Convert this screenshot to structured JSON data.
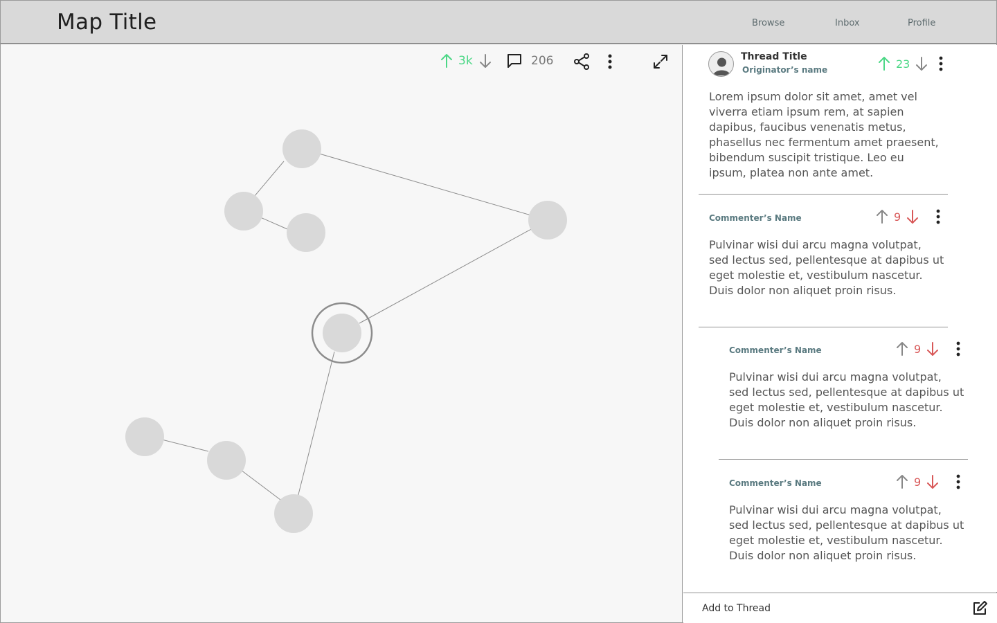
{
  "header": {
    "title": "Map Title",
    "nav": [
      "Browse",
      "Inbox",
      "Profile"
    ]
  },
  "toolbar": {
    "upvotes": "3k",
    "comments": "206",
    "icons": [
      "arrow-up-icon",
      "arrow-down-icon",
      "comment-icon",
      "share-icon",
      "more-icon",
      "expand-icon"
    ]
  },
  "colors": {
    "upvote_green": "#4cd786",
    "downvote_red": "#d85858",
    "node_fill": "#d9d9d9",
    "canvas_bg": "#f7f7f7",
    "header_bg": "#d9d9d9"
  },
  "thread": {
    "title": "Thread Title",
    "originator": "Originator’s name",
    "votes": "23",
    "body": "Lorem ipsum dolor sit amet, amet vel viverra etiam ipsum rem, at sapien dapibus, faucibus venenatis metus, phasellus nec fermentum amet praesent, bibendum suscipit tristique. Leo eu ipsum, platea non ante amet."
  },
  "comments": [
    {
      "name": "Commenter’s Name",
      "votes": "9",
      "body": "Pulvinar wisi dui arcu magna volutpat, sed lectus sed, pellentesque at dapibus ut eget molestie et, vestibulum nascetur. Duis dolor non aliquet proin risus."
    },
    {
      "name": "Commenter’s Name",
      "votes": "9",
      "body": "Pulvinar wisi dui arcu magna volutpat, sed lectus sed, pellentesque at dapibus ut eget molestie et, vestibulum nascetur. Duis dolor non aliquet proin risus."
    },
    {
      "name": "Commenter’s Name",
      "votes": "9",
      "body": "Pulvinar wisi dui arcu magna volutpat, sed lectus sed, pellentesque at dapibus ut eget molestie et, vestibulum nascetur. Duis dolor non aliquet proin risus."
    }
  ],
  "footer": {
    "add_label": "Add to Thread"
  }
}
